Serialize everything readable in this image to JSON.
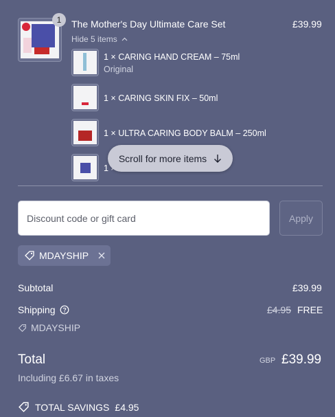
{
  "product": {
    "name": "The Mother's Day Ultimate Care Set",
    "price": "£39.99",
    "quantity_badge": "1",
    "toggle_label": "Hide 5 items",
    "items": [
      {
        "label": "1 × CARING HAND CREAM – 75ml",
        "variant": "Original"
      },
      {
        "label": "1 × CARING SKIN FIX – 50ml",
        "variant": ""
      },
      {
        "label": "1 × ULTRA CARING BODY BALM – 250ml",
        "variant": ""
      },
      {
        "label": "1 × ",
        "variant": ""
      }
    ]
  },
  "scroll_hint": "Scroll for more items",
  "discount": {
    "placeholder": "Discount code or gift card",
    "apply_label": "Apply",
    "applied_code": "MDAYSHIP"
  },
  "summary": {
    "subtotal_label": "Subtotal",
    "subtotal_value": "£39.99",
    "shipping_label": "Shipping",
    "shipping_original": "£4.95",
    "shipping_value": "FREE",
    "shipping_code": "MDAYSHIP",
    "total_label": "Total",
    "currency": "GBP",
    "total_value": "£39.99",
    "tax_note": "Including £6.67 in taxes",
    "savings_label": "TOTAL SAVINGS",
    "savings_value": "£4.95"
  },
  "colors": {
    "background": "#5a6080",
    "text": "#ffffff",
    "pill": "#c9cad6"
  }
}
